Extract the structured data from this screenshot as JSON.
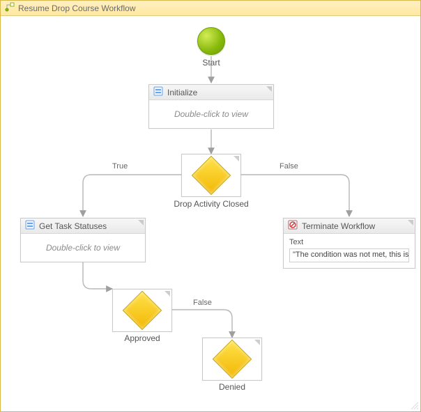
{
  "window": {
    "title": "Resume Drop Course Workflow",
    "title_icon": "workflow-icon"
  },
  "nodes": {
    "start": {
      "label": "Start"
    },
    "initialize": {
      "title": "Initialize",
      "hint": "Double-click to view",
      "icon": "activity-icon"
    },
    "dropClosed": {
      "label": "Drop Activity Closed"
    },
    "getTaskStatuses": {
      "title": "Get Task Statuses",
      "hint": "Double-click to view",
      "icon": "activity-icon"
    },
    "terminate": {
      "title": "Terminate Workflow",
      "icon": "terminate-icon",
      "text_label": "Text",
      "text_value": "\"The condition was not met, this is n"
    },
    "approved": {
      "label": "Approved"
    },
    "denied": {
      "label": "Denied"
    }
  },
  "edges": {
    "true": "True",
    "false": "False",
    "false2": "False"
  },
  "icons": {
    "workflow-icon": "⚙",
    "activity-icon": "▦",
    "terminate-icon": "⊘"
  }
}
